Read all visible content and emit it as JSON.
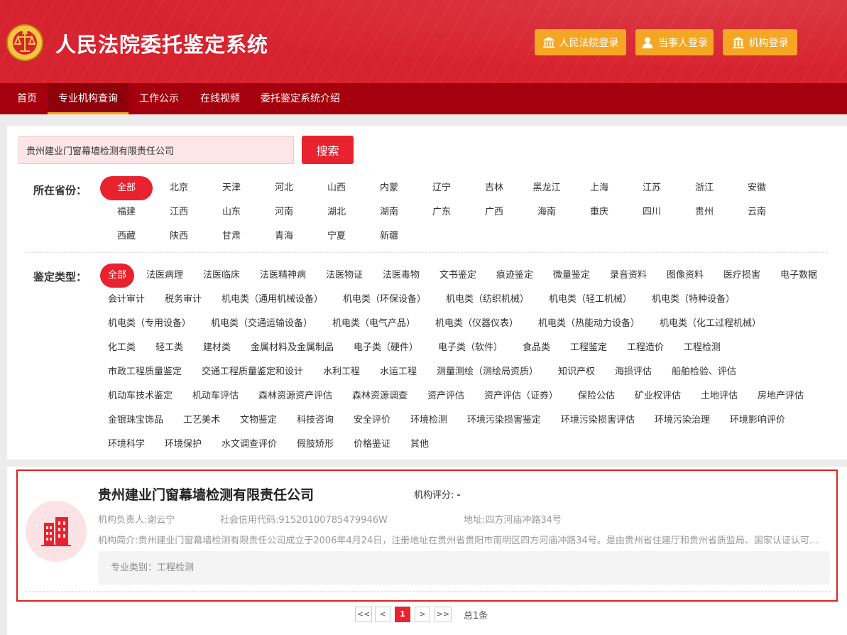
{
  "header": {
    "title": "人民法院委托鉴定系统",
    "buttons": [
      {
        "label": "人民法院登录",
        "icon": "court-building-icon"
      },
      {
        "label": "当事人登录",
        "icon": "user-icon"
      },
      {
        "label": "机构登录",
        "icon": "institution-building-icon"
      }
    ],
    "colors": {
      "primary": "#d7232f",
      "nav": "#a5000d",
      "accent": "#f5a623"
    }
  },
  "nav": {
    "items": [
      "首页",
      "专业机构查询",
      "工作公示",
      "在线视频",
      "委托鉴定系统介绍"
    ],
    "active": "专业机构查询"
  },
  "search": {
    "value": "贵州建业门窗幕墙检测有限责任公司",
    "button_label": "搜索"
  },
  "filters": {
    "province": {
      "label": "所在省份：",
      "selected": "全部",
      "options": [
        "全部",
        "北京",
        "天津",
        "河北",
        "山西",
        "内蒙",
        "辽宁",
        "吉林",
        "黑龙江",
        "上海",
        "江苏",
        "浙江",
        "安徽",
        "福建",
        "江西",
        "山东",
        "河南",
        "湖北",
        "湖南",
        "广东",
        "广西",
        "海南",
        "重庆",
        "四川",
        "贵州",
        "云南",
        "西藏",
        "陕西",
        "甘肃",
        "青海",
        "宁夏",
        "新疆"
      ]
    },
    "type": {
      "label": "鉴定类型：",
      "selected": "全部",
      "rows": [
        [
          "全部",
          "法医病理",
          "法医临床",
          "法医精神病",
          "法医物证",
          "法医毒物",
          "文书鉴定",
          "痕迹鉴定",
          "微量鉴定",
          "录音资料",
          "图像资料",
          "医疗损害",
          "电子数据"
        ],
        [
          "会计审计",
          "税务审计",
          "机电类（通用机械设备）",
          "机电类（环保设备）",
          "机电类（纺织机械）",
          "机电类（轻工机械）",
          "机电类（特种设备）"
        ],
        [
          "机电类（专用设备）",
          "机电类（交通运输设备）",
          "机电类（电气产品）",
          "机电类（仪器仪表）",
          "机电类（热能动力设备）",
          "机电类（化工过程机械）"
        ],
        [
          "化工类",
          "轻工类",
          "建材类",
          "金属材料及金属制品",
          "电子类（硬件）",
          "电子类（软件）",
          "食品类",
          "工程鉴定",
          "工程造价",
          "工程检测"
        ],
        [
          "市政工程质量鉴定",
          "交通工程质量鉴定和设计",
          "水利工程",
          "水运工程",
          "测量测绘（测绘局资质）",
          "知识产权",
          "海损评估",
          "船舶检验、评估"
        ],
        [
          "机动车技术鉴定",
          "机动车评估",
          "森林资源资产评估",
          "森林资源调查",
          "资产评估",
          "资产评估（证券）",
          "保险公估",
          "矿业权评估",
          "土地评估",
          "房地产评估"
        ],
        [
          "金银珠宝饰品",
          "工艺美术",
          "文物鉴定",
          "科技咨询",
          "安全评价",
          "环境检测",
          "环境污染损害鉴定",
          "环境污染损害评估",
          "环境污染治理",
          "环境影响评价"
        ],
        [
          "环境科学",
          "环境保护",
          "水文调查评价",
          "假肢矫形",
          "价格鉴证",
          "其他"
        ]
      ]
    }
  },
  "result": {
    "org_name": "贵州建业门窗幕墙检测有限责任公司",
    "rating_label": "机构评分:",
    "rating_value": "-",
    "leader": "机构负责人:谢云宁",
    "credit_code": "社会信用代码:91520100785479946W",
    "address": "地址:四方河庙冲路34号",
    "intro": "机构简介:贵州建业门窗幕墙检测有限责任公司成立于2006年4月24日，注册地址在贵州省贵阳市南明区四方河庙冲路34号。是由贵州省住建厅和贵州省质监局、国家认证认可监督管理委员会批准成立的专业检测机构。",
    "category": "专业类别：工程检测",
    "logo_icon": "building-icon"
  },
  "pagination": {
    "first": "<<",
    "prev": "<",
    "current": "1",
    "next": ">",
    "last": ">>",
    "total": "总1条"
  }
}
